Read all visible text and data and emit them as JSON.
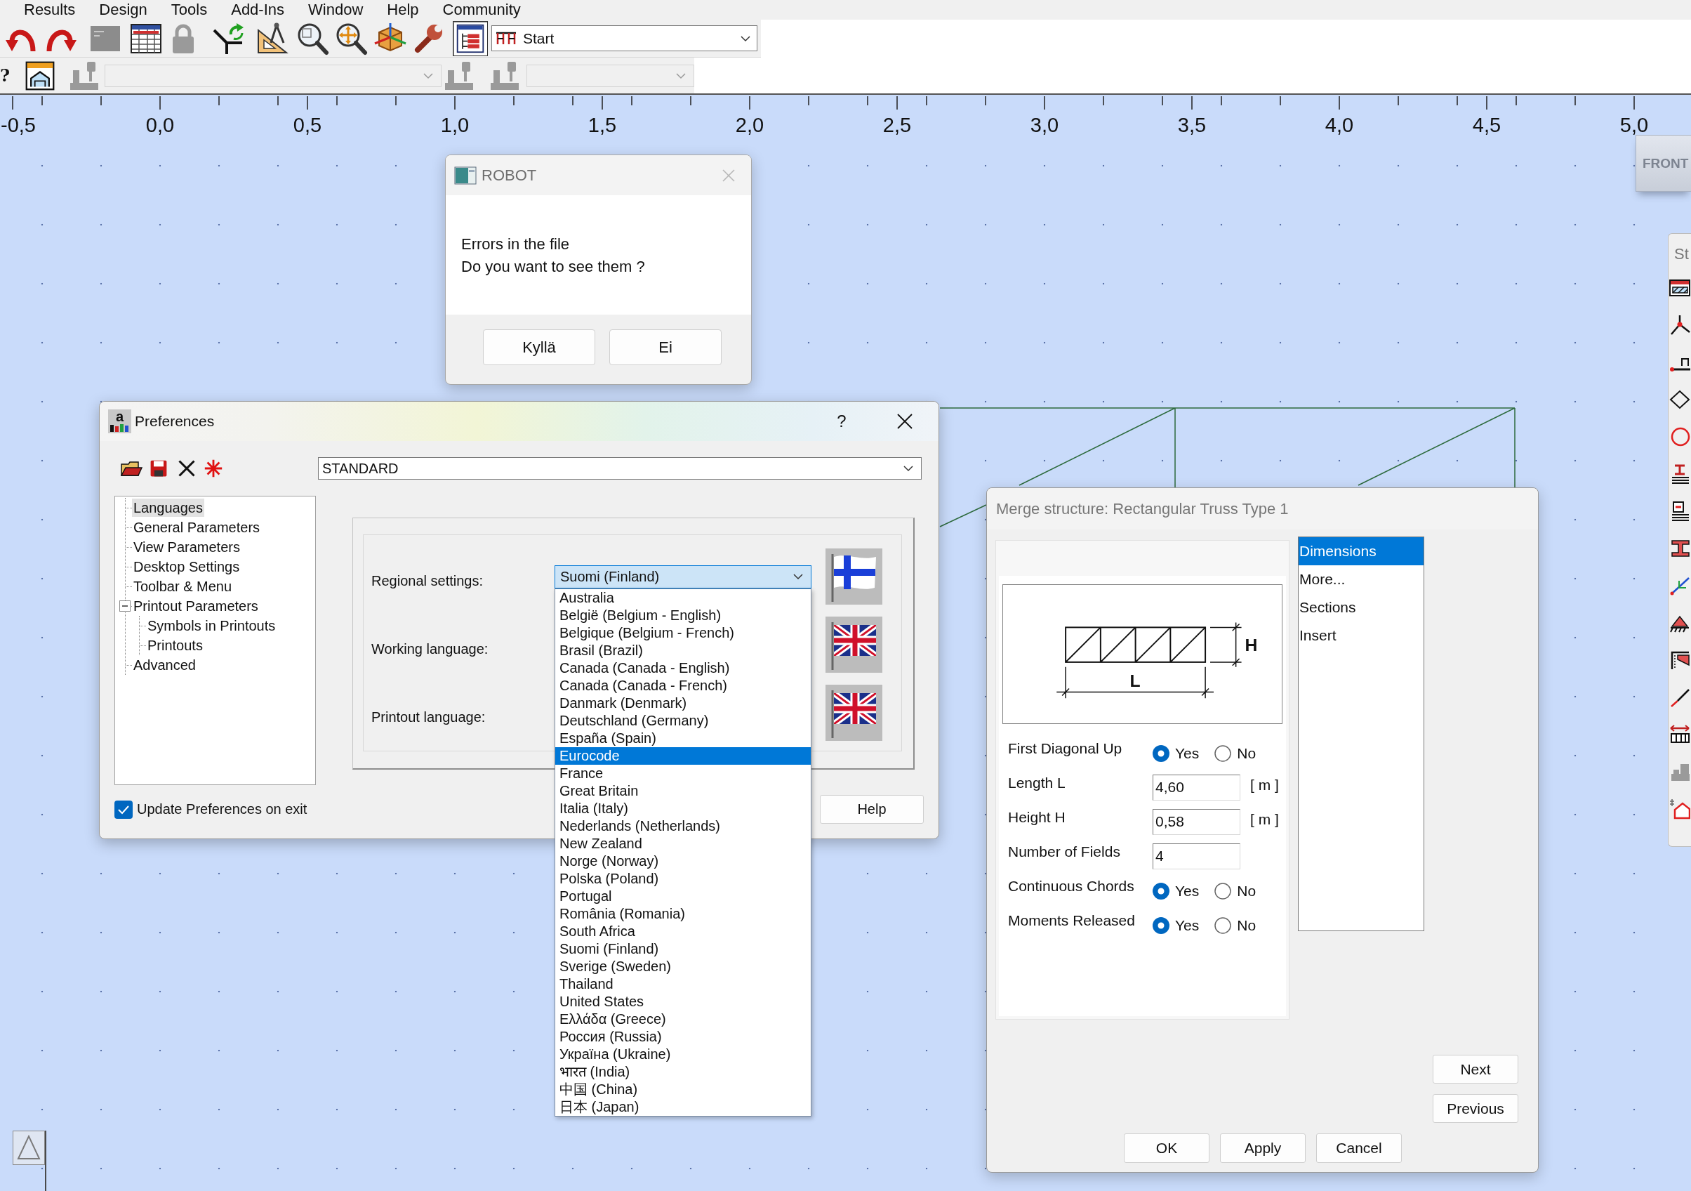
{
  "menu_bar": [
    "Results",
    "Design",
    "Tools",
    "Add-Ins",
    "Window",
    "Help",
    "Community"
  ],
  "toolbar": {
    "view_toggle": {
      "on": true
    },
    "start_combo": {
      "value": "Start"
    },
    "help_glyph": "?",
    "object_combos": [
      {
        "disabled": true
      },
      {
        "disabled": true
      }
    ]
  },
  "ruler": {
    "labels": [
      "-0,5",
      "0,0",
      "0,5",
      "1,0",
      "1,5",
      "2,0",
      "2,5",
      "3,0",
      "3,5",
      "4,0",
      "4,5",
      "5,0"
    ]
  },
  "view_cube": {
    "label": "FRONT"
  },
  "side_toolbar": {
    "title": "St"
  },
  "robot_dialog": {
    "title": "ROBOT",
    "message": [
      "Errors in the file",
      "Do you want to see them ?"
    ],
    "buttons": [
      "Kyllä",
      "Ei"
    ]
  },
  "preferences_dialog": {
    "icon_letter": "a",
    "title": "Preferences",
    "help_glyph": "?",
    "profile": {
      "value": "STANDARD"
    },
    "tree": [
      {
        "label": "Languages",
        "selected": true
      },
      {
        "label": "General Parameters",
        "selected": false
      },
      {
        "label": "View Parameters",
        "selected": false
      },
      {
        "label": "Desktop Settings",
        "selected": false
      },
      {
        "label": "Toolbar & Menu",
        "selected": false
      },
      {
        "label": "Printout Parameters",
        "selected": false,
        "expanded": true,
        "children": [
          {
            "label": "Symbols in Printouts",
            "selected": false
          },
          {
            "label": "Printouts",
            "selected": false
          }
        ]
      },
      {
        "label": "Advanced",
        "selected": false
      }
    ],
    "settings": [
      {
        "label": "Regional settings:",
        "value": "Suomi (Finland)"
      },
      {
        "label": "Working language:"
      },
      {
        "label": "Printout language:"
      }
    ],
    "regional_dropdown": {
      "open": true,
      "options": [
        {
          "label": "Australia",
          "selected": false
        },
        {
          "label": "België (Belgium - English)",
          "selected": false
        },
        {
          "label": "Belgique (Belgium - French)",
          "selected": false
        },
        {
          "label": "Brasil (Brazil)",
          "selected": false
        },
        {
          "label": "Canada (Canada - English)",
          "selected": false
        },
        {
          "label": "Canada (Canada - French)",
          "selected": false
        },
        {
          "label": "Danmark (Denmark)",
          "selected": false
        },
        {
          "label": "Deutschland (Germany)",
          "selected": false
        },
        {
          "label": "España (Spain)",
          "selected": false
        },
        {
          "label": "Eurocode",
          "selected": true
        },
        {
          "label": "France",
          "selected": false
        },
        {
          "label": "Great Britain",
          "selected": false
        },
        {
          "label": "Italia (Italy)",
          "selected": false
        },
        {
          "label": "Nederlands (Netherlands)",
          "selected": false
        },
        {
          "label": "New Zealand",
          "selected": false
        },
        {
          "label": "Norge (Norway)",
          "selected": false
        },
        {
          "label": "Polska (Poland)",
          "selected": false
        },
        {
          "label": "Portugal",
          "selected": false
        },
        {
          "label": "România (Romania)",
          "selected": false
        },
        {
          "label": "South Africa",
          "selected": false
        },
        {
          "label": "Suomi (Finland)",
          "selected": false
        },
        {
          "label": "Sverige (Sweden)",
          "selected": false
        },
        {
          "label": "Thailand",
          "selected": false
        },
        {
          "label": "United States",
          "selected": false
        },
        {
          "label": "Ελλάδα (Greece)",
          "selected": false
        },
        {
          "label": "Россия (Russia)",
          "selected": false
        },
        {
          "label": "Україна (Ukraine)",
          "selected": false
        },
        {
          "label": "भारत (India)",
          "selected": false
        },
        {
          "label": "中国 (China)",
          "selected": false
        },
        {
          "label": "日本 (Japan)",
          "selected": false
        }
      ]
    },
    "update_on_exit": {
      "label": "Update Preferences on exit",
      "checked": true
    },
    "buttons": [
      "Help"
    ]
  },
  "merge_dialog": {
    "title": "Merge structure: Rectangular Truss Type 1",
    "diagram_labels": {
      "height": "H",
      "length": "L"
    },
    "fields": [
      {
        "kind": "radio",
        "label": "First Diagonal Up",
        "options": [
          {
            "label": "Yes",
            "selected": true
          },
          {
            "label": "No",
            "selected": false
          }
        ]
      },
      {
        "kind": "input",
        "label": "Length L",
        "value": "4,60",
        "unit": "[ m ]"
      },
      {
        "kind": "input",
        "label": "Height H",
        "value": "0,58",
        "unit": "[ m ]"
      },
      {
        "kind": "input",
        "label": "Number of Fields",
        "value": "4"
      },
      {
        "kind": "radio",
        "label": "Continuous Chords",
        "options": [
          {
            "label": "Yes",
            "selected": true
          },
          {
            "label": "No",
            "selected": false
          }
        ]
      },
      {
        "kind": "radio",
        "label": "Moments Released",
        "options": [
          {
            "label": "Yes",
            "selected": true
          },
          {
            "label": "No",
            "selected": false
          }
        ]
      }
    ],
    "pages": [
      {
        "label": "Dimensions",
        "selected": true
      },
      {
        "label": "More...",
        "selected": false
      },
      {
        "label": "Sections",
        "selected": false
      },
      {
        "label": "Insert",
        "selected": false
      }
    ],
    "nav_buttons": [
      "Next",
      "Previous"
    ],
    "buttons": [
      "OK",
      "Apply",
      "Cancel"
    ]
  }
}
